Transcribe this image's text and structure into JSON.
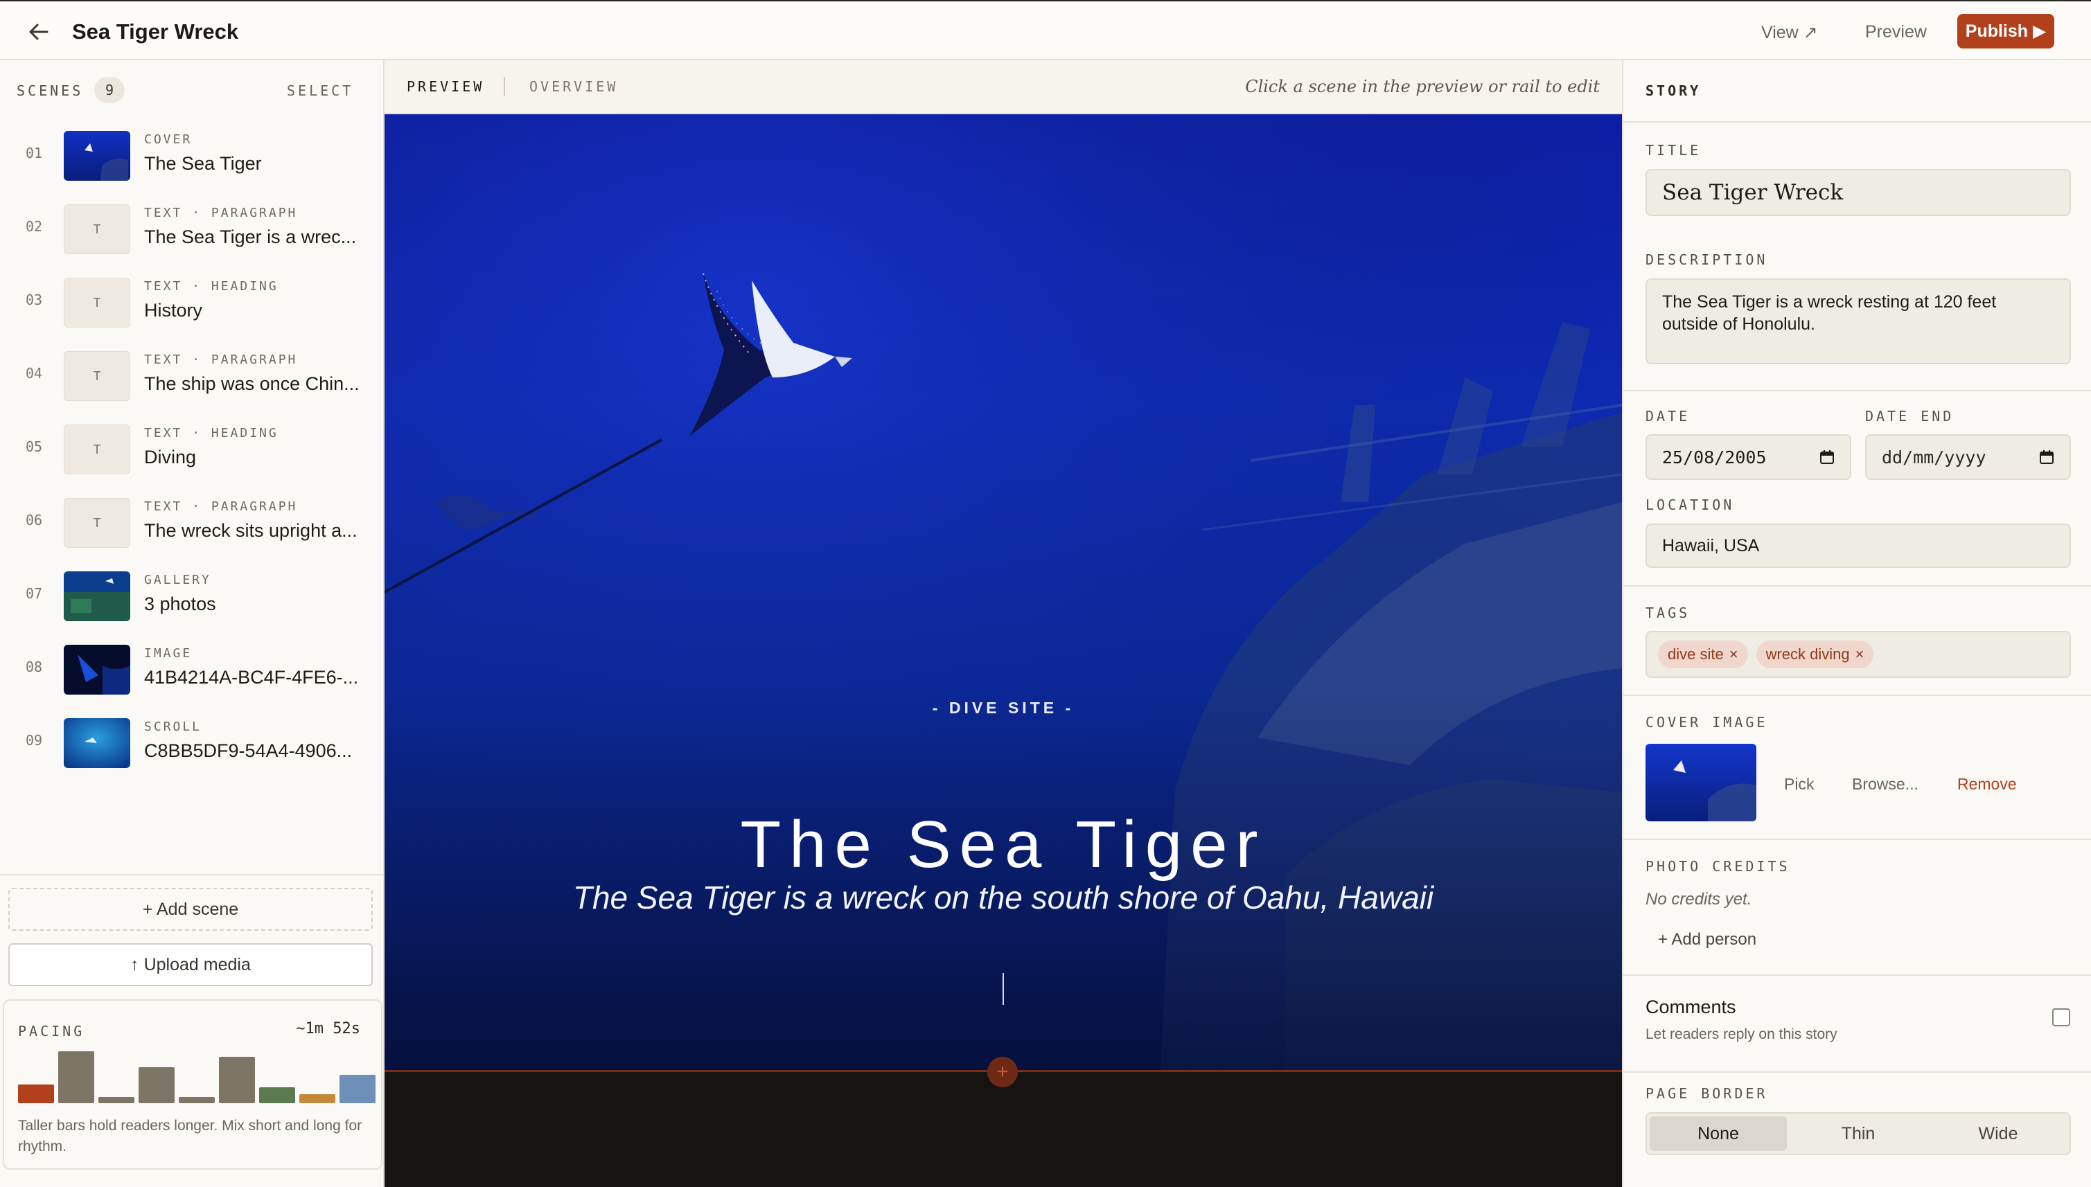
{
  "header": {
    "title": "Sea Tiger Wreck",
    "view_label": "View ↗",
    "preview_label": "Preview",
    "publish_label": "Publish ▶"
  },
  "scenes": {
    "label": "SCENES",
    "count": "9",
    "select_label": "SELECT",
    "items": [
      {
        "num": "01",
        "type": "COVER",
        "title": "The Sea Tiger",
        "thumb": "image"
      },
      {
        "num": "02",
        "type": "TEXT · PARAGRAPH",
        "title": "The Sea Tiger is a wrec...",
        "thumb": "T"
      },
      {
        "num": "03",
        "type": "TEXT · HEADING",
        "title": "History",
        "thumb": "T"
      },
      {
        "num": "04",
        "type": "TEXT · PARAGRAPH",
        "title": "The ship was once Chin...",
        "thumb": "T"
      },
      {
        "num": "05",
        "type": "TEXT · HEADING",
        "title": "Diving",
        "thumb": "T"
      },
      {
        "num": "06",
        "type": "TEXT · PARAGRAPH",
        "title": "The wreck sits upright a...",
        "thumb": "T"
      },
      {
        "num": "07",
        "type": "GALLERY",
        "title": "3 photos",
        "thumb": "image"
      },
      {
        "num": "08",
        "type": "IMAGE",
        "title": "41B4214A-BC4F-4FE6-...",
        "thumb": "image"
      },
      {
        "num": "09",
        "type": "SCROLL",
        "title": "C8BB5DF9-54A4-4906...",
        "thumb": "image"
      }
    ],
    "add_scene_label": "+ Add scene",
    "upload_label": "↑ Upload media"
  },
  "pacing": {
    "label": "PACING",
    "total": "~1m 52s",
    "help": "Taller bars hold readers longer. Mix short and long for rhythm.",
    "bars": [
      {
        "level": 0.34,
        "color": "#b3401c"
      },
      {
        "level": 0.96,
        "color": "#7d7565"
      },
      {
        "level": 0.12,
        "color": "#7d7565"
      },
      {
        "level": 0.67,
        "color": "#7d7565"
      },
      {
        "level": 0.12,
        "color": "#7d7565"
      },
      {
        "level": 0.86,
        "color": "#7d7565"
      },
      {
        "level": 0.3,
        "color": "#5b7a52"
      },
      {
        "level": 0.17,
        "color": "#c48a3a"
      },
      {
        "level": 0.52,
        "color": "#6d8fb8"
      }
    ]
  },
  "center": {
    "tab_preview": "PREVIEW",
    "tab_overview": "OVERVIEW",
    "hint": "Click a scene in the preview or rail to edit",
    "kicker": "- DIVE SITE -",
    "title": "The Sea Tiger",
    "subtitle": "The Sea Tiger is a wreck on the south shore of Oahu, Hawaii",
    "add_between": "+"
  },
  "story": {
    "section_label": "STORY",
    "title_label": "TITLE",
    "title_value": "Sea Tiger Wreck",
    "description_label": "DESCRIPTION",
    "description_value": "The Sea Tiger is a wreck resting at 120 feet outside of Honolulu.",
    "date_label": "DATE",
    "date_value": "25/08/2005",
    "date_end_label": "DATE END",
    "date_end_value": "dd/mm/yyyy",
    "location_label": "LOCATION",
    "location_value": "Hawaii, USA",
    "tags_label": "TAGS",
    "tags": [
      "dive site",
      "wreck diving"
    ],
    "cover_label": "COVER IMAGE",
    "cover_pick": "Pick",
    "cover_browse": "Browse...",
    "cover_remove": "Remove",
    "credits_label": "PHOTO CREDITS",
    "credits_empty": "No credits yet.",
    "add_person": "+ Add person",
    "comments_title": "Comments",
    "comments_sub": "Let readers reply on this story",
    "border_label": "PAGE BORDER",
    "border_options": [
      "None",
      "Thin",
      "Wide"
    ]
  }
}
